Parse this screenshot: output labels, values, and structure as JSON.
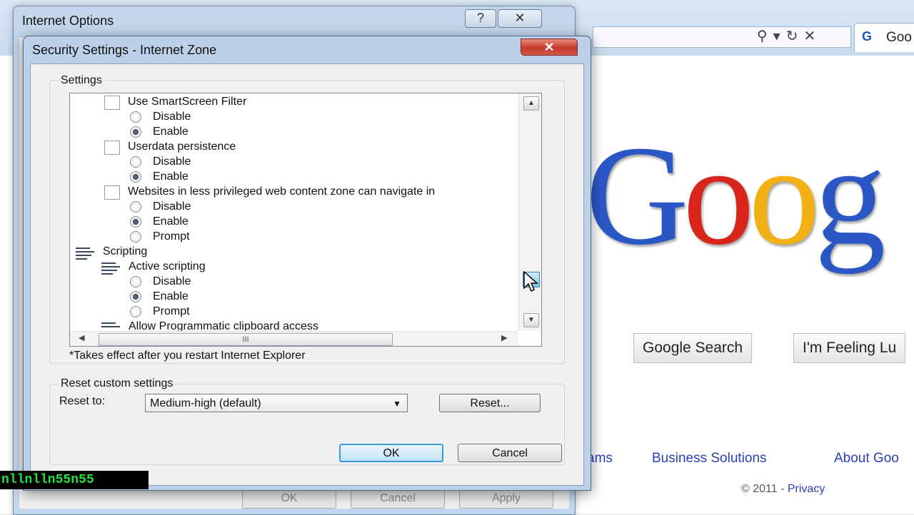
{
  "browser": {
    "tab_label": "Goo",
    "tab_favicon": "G",
    "logo_letters": [
      "G",
      "o",
      "o",
      "g"
    ],
    "buttons": {
      "search": "Google Search",
      "lucky": "I'm Feeling Lu"
    },
    "links": {
      "programs_fragment": "ams",
      "business": "Business Solutions",
      "about": "About Goo"
    },
    "copyright": "© 2011 -",
    "privacy": "Privacy",
    "colors": {
      "blue": "#2b57c6",
      "red": "#d8241b",
      "yellow": "#f2b014",
      "link": "#2a3fb8"
    }
  },
  "internet_options": {
    "title": "Internet Options",
    "help_button": "?",
    "close_button": "✕",
    "footer_buttons": {
      "ok": "OK",
      "cancel": "Cancel",
      "apply": "Apply"
    }
  },
  "dialog": {
    "title": "Security Settings - Internet Zone",
    "close_button": "✕",
    "settings_label": "Settings",
    "tree": {
      "smartscreen": {
        "label": "Use SmartScreen Filter",
        "disable": "Disable",
        "enable": "Enable",
        "selected": "Enable"
      },
      "userdata": {
        "label": "Userdata persistence",
        "disable": "Disable",
        "enable": "Enable",
        "selected": "Enable"
      },
      "navigate": {
        "label": "Websites in less privileged web content zone can navigate in",
        "disable": "Disable",
        "enable": "Enable",
        "prompt": "Prompt",
        "selected": "Enable"
      },
      "scripting": {
        "label": "Scripting"
      },
      "active_scripting": {
        "label": "Active scripting",
        "disable": "Disable",
        "enable": "Enable",
        "prompt": "Prompt",
        "selected": "Enable"
      },
      "clipboard": {
        "label": "Allow Programmatic clipboard access"
      }
    },
    "hscroll_grip": "III",
    "footnote": "*Takes effect after you restart Internet Explorer",
    "reset_group_label": "Reset custom settings",
    "reset_to_label": "Reset to:",
    "reset_select_value": "Medium-high (default)",
    "reset_button": "Reset...",
    "ok_button": "OK",
    "cancel_button": "Cancel"
  },
  "overlay_text": "nllnlln55n55"
}
